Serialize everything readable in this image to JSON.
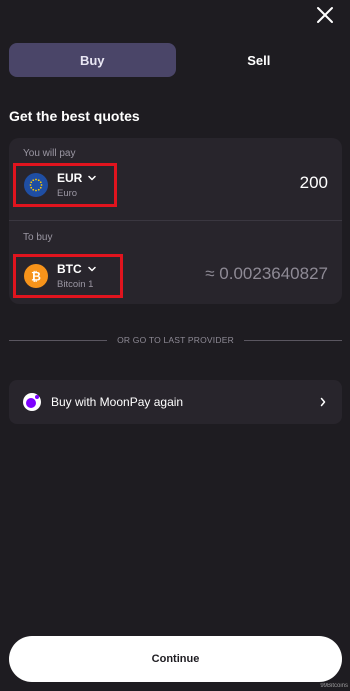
{
  "tabs": [
    {
      "label": "Buy",
      "active": true
    },
    {
      "label": "Sell",
      "active": false
    }
  ],
  "heading": "Get the best quotes",
  "pay": {
    "label": "You will pay",
    "currency_code": "EUR",
    "currency_name": "Euro",
    "amount": "200",
    "icon": "euro-coin-icon"
  },
  "receive": {
    "label": "To buy",
    "currency_code": "BTC",
    "currency_name": "Bitcoin 1",
    "amount": "≈ 0.0023640827",
    "icon": "bitcoin-coin-icon"
  },
  "divider_text": "OR GO TO LAST PROVIDER",
  "provider": {
    "label": "Buy with MoonPay again"
  },
  "continue_label": "Continue",
  "watermark": "99Bitcoins",
  "colors": {
    "background": "#1e1c21",
    "card": "#28252c",
    "active_tab": "#4a4568",
    "highlight": "#e0141e",
    "btc": "#f7931a",
    "eur": "#1f4ea3",
    "moonpay": "#7d00ff"
  }
}
